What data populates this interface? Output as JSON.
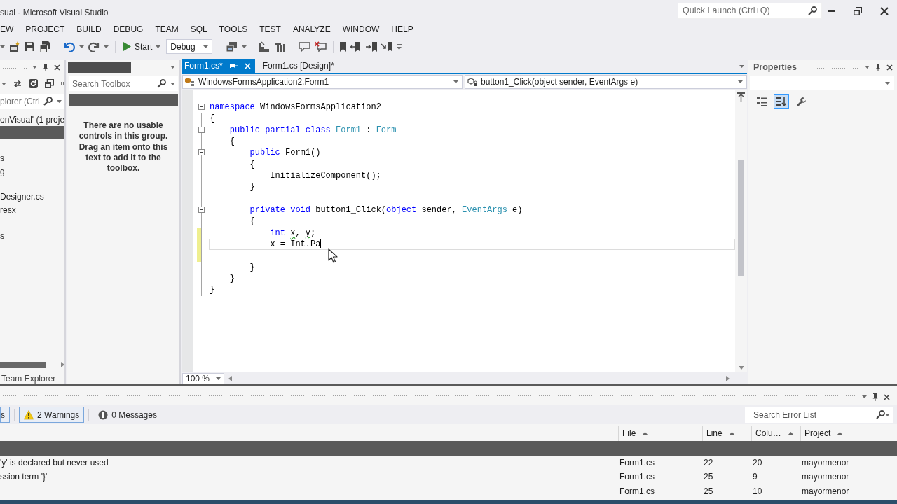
{
  "window": {
    "title": "sual - Microsoft Visual Studio"
  },
  "quick_launch": {
    "placeholder": "Quick Launch (Ctrl+Q)"
  },
  "menu": [
    "EW",
    "PROJECT",
    "BUILD",
    "DEBUG",
    "TEAM",
    "SQL",
    "TOOLS",
    "TEST",
    "ANALYZE",
    "WINDOW",
    "HELP"
  ],
  "toolbar": {
    "start": "Start",
    "configuration": "Debug"
  },
  "solution_explorer": {
    "search": {
      "placeholder": "plorer (Ctrl"
    },
    "items": [
      {
        "label": "onVisual' (1 proje",
        "selected": false
      },
      {
        "selected": true
      },
      {
        "selected": false
      },
      {
        "label": "s",
        "selected": false
      },
      {
        "label": "g",
        "selected": false
      },
      {
        "selected": false
      },
      {
        "label": "Designer.cs",
        "selected": false
      },
      {
        "label": "resx",
        "selected": false
      },
      {
        "selected": false
      },
      {
        "label": "s",
        "selected": false
      }
    ],
    "tabs": [
      {
        "label": "Team Explorer",
        "selected": false
      }
    ]
  },
  "toolbox": {
    "search": {
      "placeholder": "Search Toolbox"
    },
    "message": "There are no usable controls in this group. Drag an item onto this text to add it to the toolbox."
  },
  "editor": {
    "tabs": [
      {
        "label": "Form1.cs*",
        "selected": true
      },
      {
        "label": "Form1.cs [Design]*",
        "selected": false
      }
    ],
    "navigation": {
      "type": "WindowsFormsApplication2.Form1",
      "member": "button1_Click(object sender, EventArgs e)"
    },
    "lines": [
      {
        "collapsible": true,
        "changed": false,
        "current": false,
        "tokens": [
          {
            "kind": "keyword",
            "text": "namespace"
          },
          {
            "kind": "plain",
            "text": " WindowsFormsApplication2"
          }
        ]
      },
      {
        "collapsible": false,
        "changed": false,
        "current": false,
        "tokens": [
          {
            "kind": "plain",
            "text": "{"
          }
        ]
      },
      {
        "collapsible": true,
        "changed": false,
        "current": false,
        "tokens": [
          {
            "kind": "keyword",
            "text": "    public partial class "
          },
          {
            "kind": "type",
            "text": "Form1"
          },
          {
            "kind": "plain",
            "text": " : "
          },
          {
            "kind": "type",
            "text": "Form"
          }
        ]
      },
      {
        "collapsible": false,
        "changed": false,
        "current": false,
        "tokens": [
          {
            "kind": "plain",
            "text": "    {"
          }
        ]
      },
      {
        "collapsible": true,
        "changed": false,
        "current": false,
        "tokens": [
          {
            "kind": "keyword",
            "text": "        public"
          },
          {
            "kind": "plain",
            "text": " Form1()"
          }
        ]
      },
      {
        "collapsible": false,
        "changed": false,
        "current": false,
        "tokens": [
          {
            "kind": "plain",
            "text": "        {"
          }
        ]
      },
      {
        "collapsible": false,
        "changed": false,
        "current": false,
        "tokens": [
          {
            "kind": "plain",
            "text": "            InitializeComponent();"
          }
        ]
      },
      {
        "collapsible": false,
        "changed": false,
        "current": false,
        "tokens": [
          {
            "kind": "plain",
            "text": "        }"
          }
        ]
      },
      {
        "collapsible": false,
        "changed": false,
        "current": false
      },
      {
        "collapsible": true,
        "changed": false,
        "current": false,
        "tokens": [
          {
            "kind": "keyword",
            "text": "        private void"
          },
          {
            "kind": "plain",
            "text": " button1_Click("
          },
          {
            "kind": "keyword",
            "text": "object"
          },
          {
            "kind": "plain",
            "text": " sender, "
          },
          {
            "kind": "type",
            "text": "EventArgs"
          },
          {
            "kind": "plain",
            "text": " e)"
          }
        ]
      },
      {
        "collapsible": false,
        "changed": false,
        "current": false,
        "tokens": [
          {
            "kind": "plain",
            "text": "        {"
          }
        ]
      },
      {
        "collapsible": false,
        "changed": true,
        "current": false,
        "tokens": [
          {
            "kind": "keyword",
            "text": "            int "
          },
          {
            "kind": "warning",
            "text": "x"
          },
          {
            "kind": "plain",
            "text": ", "
          },
          {
            "kind": "warning",
            "text": "y"
          },
          {
            "kind": "plain",
            "text": ";"
          }
        ]
      },
      {
        "collapsible": false,
        "changed": true,
        "current": true,
        "tokens": [
          {
            "kind": "plain",
            "text": "            x = Int.Pa"
          }
        ]
      },
      {
        "collapsible": false,
        "changed": true,
        "current": false
      },
      {
        "collapsible": false,
        "changed": false,
        "current": false,
        "tokens": [
          {
            "kind": "plain",
            "text": "        }"
          }
        ]
      },
      {
        "collapsible": false,
        "changed": false,
        "current": false,
        "tokens": [
          {
            "kind": "plain",
            "text": "    }"
          }
        ]
      },
      {
        "collapsible": false,
        "changed": false,
        "current": false,
        "tokens": [
          {
            "kind": "plain",
            "text": "}"
          }
        ]
      }
    ],
    "zoom": "100 %"
  },
  "properties": {
    "title": "Properties",
    "buttons": [
      {
        "kind": "categorized",
        "selected": false
      },
      {
        "kind": "alphabetical",
        "selected": true
      },
      {
        "kind": "pages",
        "selected": false
      }
    ]
  },
  "error_list": {
    "filters": [
      {
        "kind": "error",
        "label": "s",
        "selected": true
      },
      {
        "kind": "warning",
        "label": "2 Warnings",
        "selected": true
      },
      {
        "kind": "message",
        "label": "0 Messages",
        "selected": false
      }
    ],
    "search": {
      "placeholder": "Search Error List"
    },
    "columns": [
      {
        "label": "File"
      },
      {
        "label": "Line"
      },
      {
        "label": "Colu…"
      },
      {
        "label": "Project"
      }
    ],
    "rows": [
      {
        "selected": true
      },
      {
        "column_1": "'y' is declared but never used",
        "file": "Form1.cs",
        "line": "22",
        "column": "20",
        "project": "mayormenor",
        "selected": false
      },
      {
        "column_1": "ssion term '}'",
        "file": "Form1.cs",
        "line": "25",
        "column": "9",
        "project": "mayormenor",
        "selected": false
      },
      {
        "file": "Form1.cs",
        "line": "25",
        "column": "10",
        "project": "mayormenor",
        "selected": false
      }
    ]
  }
}
